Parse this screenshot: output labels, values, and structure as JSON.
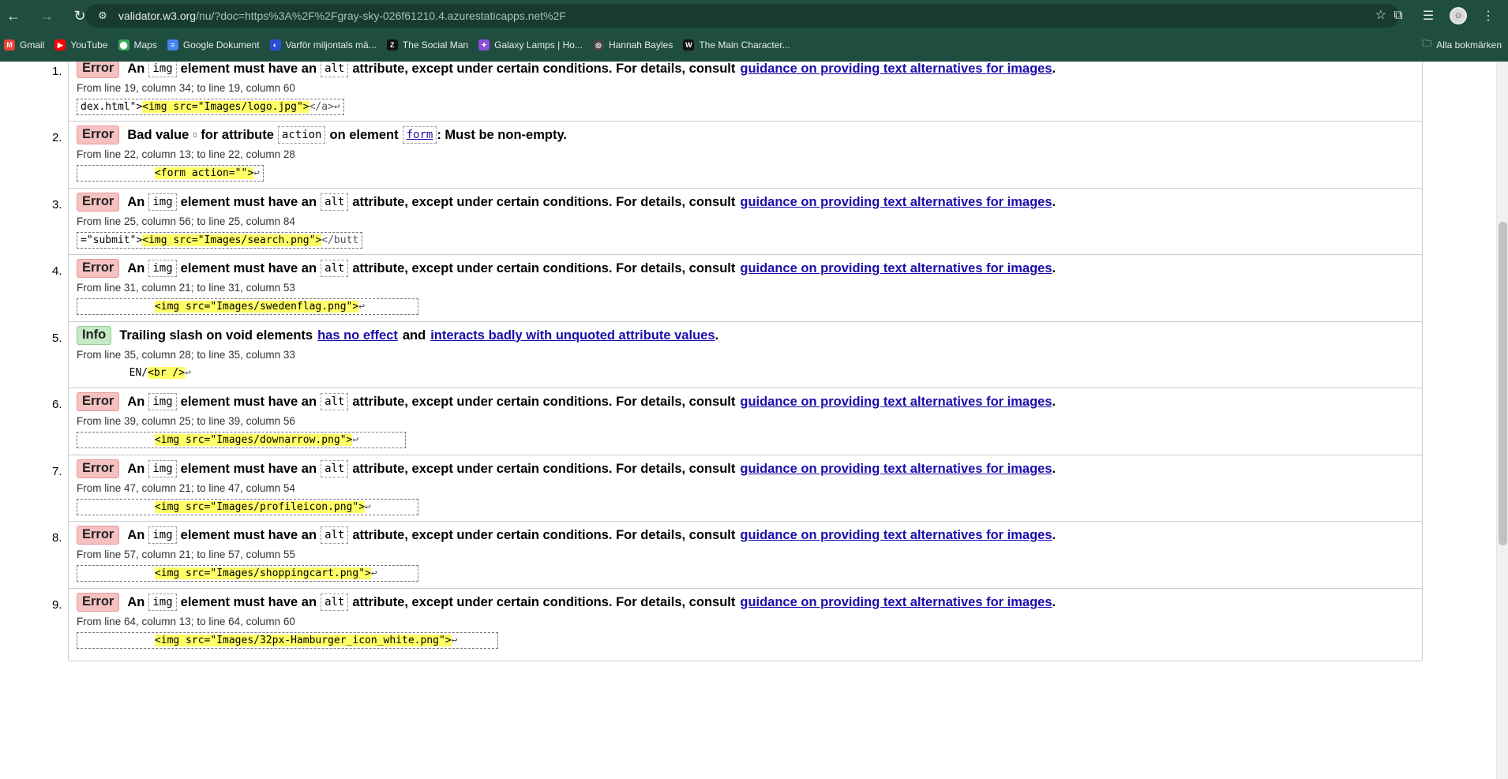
{
  "browser": {
    "url_host": "validator.w3.org",
    "url_rest": "/nu/?doc=https%3A%2F%2Fgray-sky-026f61210.4.azurestaticapps.net%2F",
    "bookmarks": [
      {
        "label": "Gmail",
        "icon": "gmail-icon",
        "color": "#ea4335",
        "glyph": "M"
      },
      {
        "label": "YouTube",
        "icon": "youtube-icon",
        "color": "#ff0000",
        "glyph": "▶"
      },
      {
        "label": "Maps",
        "icon": "maps-icon",
        "color": "#34a853",
        "glyph": "⬤"
      },
      {
        "label": "Google Dokument",
        "icon": "docs-icon",
        "color": "#4285f4",
        "glyph": "≡"
      },
      {
        "label": "Varför miljontals mä...",
        "icon": "moon-icon",
        "color": "#2a4fd6",
        "glyph": "◐"
      },
      {
        "label": "The Social Man",
        "icon": "social-man-icon",
        "color": "#111111",
        "glyph": "Z"
      },
      {
        "label": "Galaxy Lamps | Ho...",
        "icon": "galaxy-icon",
        "color": "#8a4fd6",
        "glyph": "✦"
      },
      {
        "label": "Hannah Bayles",
        "icon": "globe-icon",
        "color": "#444444",
        "glyph": "◎"
      },
      {
        "label": "The Main Character...",
        "icon": "main-character-icon",
        "color": "#111111",
        "glyph": "W"
      }
    ],
    "all_bookmarks": "Alla bokmärken"
  },
  "messages": [
    {
      "n": "1.",
      "type": "Error",
      "head": {
        "pre": "An",
        "code1": "img",
        "mid": "element must have an",
        "code2": "alt",
        "post": "attribute, except under certain conditions. For details, consult",
        "link": "guidance on providing text alternatives for images",
        "end": "."
      },
      "loc": "From line 19, column 34; to line 19, column 60",
      "extract_pre": "dex.html\">",
      "extract_hl": "<img src=\"Images/logo.jpg\">",
      "extract_post": "</a>↩"
    },
    {
      "n": "2.",
      "type": "Error",
      "head_bad": {
        "pre": "Bad value",
        "code0": "",
        "mid1": "for attribute",
        "code1": "action",
        "mid2": "on element",
        "code2": "form",
        "post": ": Must be non-empty."
      },
      "loc": "From line 22, column 13; to line 22, column 28",
      "extract_pre": "            ",
      "extract_hl": "<form action=\"\">",
      "extract_post": "↩"
    },
    {
      "n": "3.",
      "type": "Error",
      "head": {
        "pre": "An",
        "code1": "img",
        "mid": "element must have an",
        "code2": "alt",
        "post": "attribute, except under certain conditions. For details, consult",
        "link": "guidance on providing text alternatives for images",
        "end": "."
      },
      "loc": "From line 25, column 56; to line 25, column 84",
      "extract_pre": "=\"submit\">",
      "extract_hl": "<img src=\"Images/search.png\">",
      "extract_post": "</butt"
    },
    {
      "n": "4.",
      "type": "Error",
      "head": {
        "pre": "An",
        "code1": "img",
        "mid": "element must have an",
        "code2": "alt",
        "post": "attribute, except under certain conditions. For details, consult",
        "link": "guidance on providing text alternatives for images",
        "end": "."
      },
      "loc": "From line 31, column 21; to line 31, column 53",
      "extract_pre": "            ",
      "extract_hl": "<img src=\"Images/swedenflag.png\">",
      "extract_post": "↩        "
    },
    {
      "n": "5.",
      "type": "Info",
      "head_info": {
        "pre": "Trailing slash on void elements",
        "link1": "has no effect",
        "mid": "and",
        "link2": "interacts badly with unquoted attribute values",
        "end": "."
      },
      "loc": "From line 35, column 28; to line 35, column 33",
      "extract_pre": "        EN/",
      "extract_hl": "<br />",
      "extract_post": "↩"
    },
    {
      "n": "6.",
      "type": "Error",
      "head": {
        "pre": "An",
        "code1": "img",
        "mid": "element must have an",
        "code2": "alt",
        "post": "attribute, except under certain conditions. For details, consult",
        "link": "guidance on providing text alternatives for images",
        "end": "."
      },
      "loc": "From line 39, column 25; to line 39, column 56",
      "extract_pre": "            ",
      "extract_hl": "<img src=\"Images/downarrow.png\">",
      "extract_post": "↩       "
    },
    {
      "n": "7.",
      "type": "Error",
      "head": {
        "pre": "An",
        "code1": "img",
        "mid": "element must have an",
        "code2": "alt",
        "post": "attribute, except under certain conditions. For details, consult",
        "link": "guidance on providing text alternatives for images",
        "end": "."
      },
      "loc": "From line 47, column 21; to line 47, column 54",
      "extract_pre": "            ",
      "extract_hl": "<img src=\"Images/profileicon.png\">",
      "extract_post": "↩       "
    },
    {
      "n": "8.",
      "type": "Error",
      "head": {
        "pre": "An",
        "code1": "img",
        "mid": "element must have an",
        "code2": "alt",
        "post": "attribute, except under certain conditions. For details, consult",
        "link": "guidance on providing text alternatives for images",
        "end": "."
      },
      "loc": "From line 57, column 21; to line 57, column 55",
      "extract_pre": "            ",
      "extract_hl": "<img src=\"Images/shoppingcart.png\">",
      "extract_post": "↩      "
    },
    {
      "n": "9.",
      "type": "Error",
      "head": {
        "pre": "An",
        "code1": "img",
        "mid": "element must have an",
        "code2": "alt",
        "post": "attribute, except under certain conditions. For details, consult",
        "link": "guidance on providing text alternatives for images",
        "end": "."
      },
      "loc": "From line 64, column 13; to line 64, column 60",
      "extract_pre": "            ",
      "extract_hl": "<img src=\"Images/32px-Hamburger_icon_white.png\">",
      "extract_post": "↩      "
    }
  ]
}
